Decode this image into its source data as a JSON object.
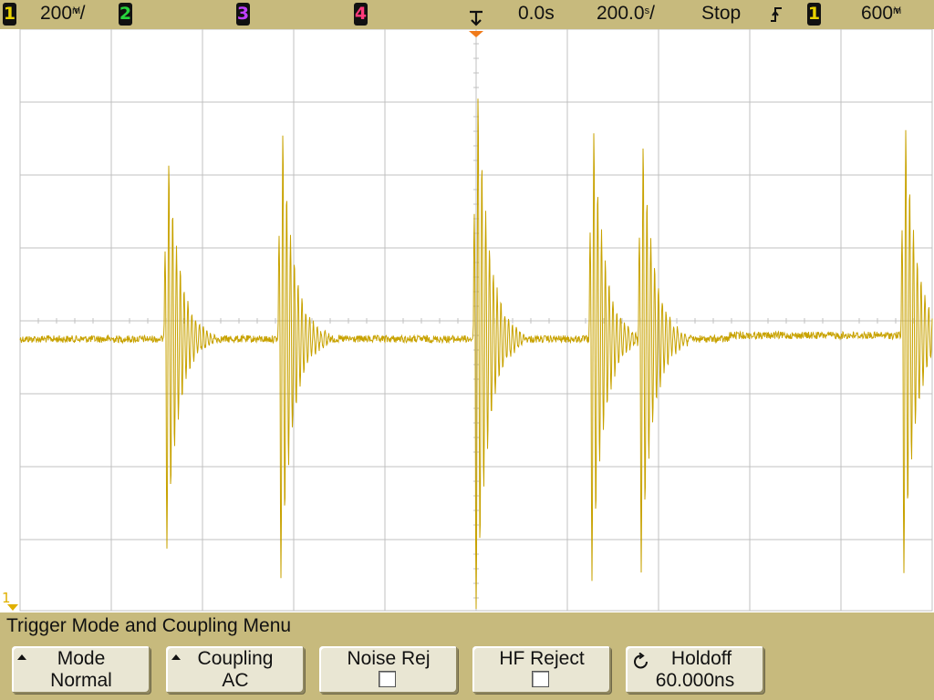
{
  "colors": {
    "trace": "#c8a200",
    "grid": "#c0c0c0",
    "bar": "#c7ba7d",
    "softkey": "#e9e6d3"
  },
  "status_bar": {
    "ch1_label": "1",
    "ch1_scale": "200",
    "ch2_label": "2",
    "ch3_label": "3",
    "ch4_label": "4",
    "time_position": "0.0s",
    "time_scale": "200.0",
    "run_state": "Stop",
    "trigger_slope_icon": "rising-edge-icon",
    "trigger_source": "1",
    "trigger_level": "600"
  },
  "ground_marker": {
    "label": "1"
  },
  "menu": {
    "title": "Trigger Mode and Coupling Menu",
    "softkeys": [
      {
        "label": "Mode",
        "value": "Normal"
      },
      {
        "label": "Coupling",
        "value": "AC"
      },
      {
        "label": "Noise Rej",
        "value": ""
      },
      {
        "label": "HF Reject",
        "value": ""
      },
      {
        "label": "Holdoff",
        "value": "60.000ns"
      }
    ]
  },
  "waveform": {
    "bursts": [
      {
        "t": 182,
        "amp": 0.95
      },
      {
        "t": 307,
        "amp": 1.1
      },
      {
        "t": 521,
        "amp": 1.3
      },
      {
        "t": 648,
        "amp": 1.1
      },
      {
        "t": 702,
        "amp": 1.05
      },
      {
        "t": 990,
        "amp": 1.1
      }
    ]
  }
}
